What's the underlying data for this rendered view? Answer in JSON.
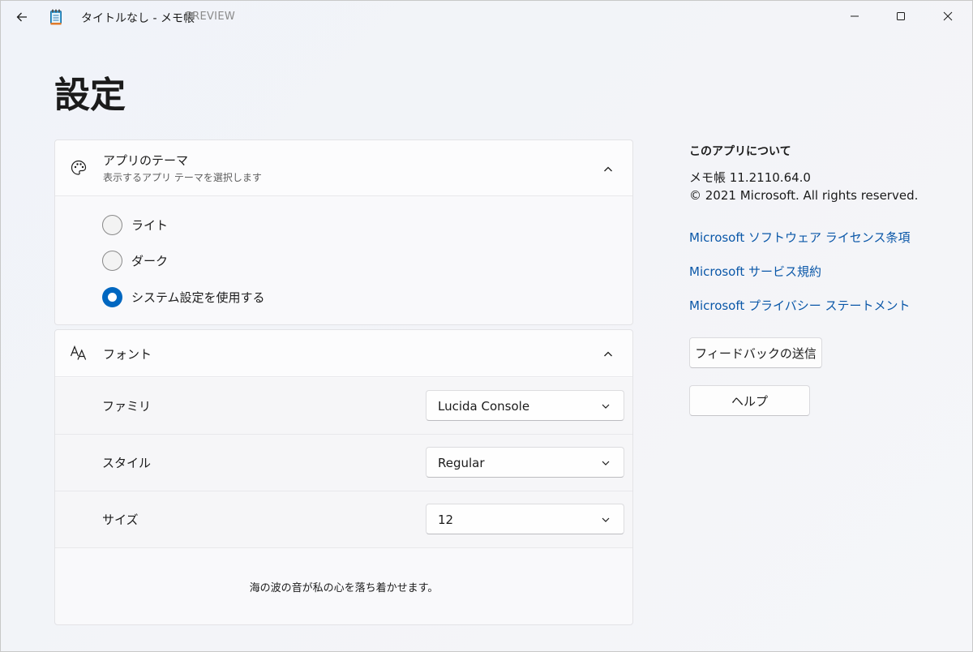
{
  "window": {
    "title": "タイトルなし - メモ帳",
    "preview_tag": "PREVIEW"
  },
  "page": {
    "title": "設定"
  },
  "theme_card": {
    "title": "アプリのテーマ",
    "subtitle": "表示するアプリ テーマを選択します",
    "icon": "palette-icon",
    "options": [
      {
        "label": "ライト",
        "selected": false
      },
      {
        "label": "ダーク",
        "selected": false
      },
      {
        "label": "システム設定を使用する",
        "selected": true
      }
    ]
  },
  "font_card": {
    "title": "フォント",
    "icon": "font-icon",
    "rows": [
      {
        "label": "ファミリ",
        "value": "Lucida Console"
      },
      {
        "label": "スタイル",
        "value": "Regular"
      },
      {
        "label": "サイズ",
        "value": "12"
      }
    ],
    "preview": "海の波の音が私の心を落ち着かせます。"
  },
  "about": {
    "title": "このアプリについて",
    "version": "メモ帳 11.2110.64.0",
    "copyright": "© 2021 Microsoft. All rights reserved.",
    "links": [
      "Microsoft ソフトウェア ライセンス条項",
      "Microsoft サービス規約",
      "Microsoft プライバシー ステートメント"
    ],
    "feedback_button": "フィードバックの送信",
    "help_button": "ヘルプ"
  },
  "colors": {
    "accent": "#0067c0",
    "link": "#0a57a8"
  }
}
